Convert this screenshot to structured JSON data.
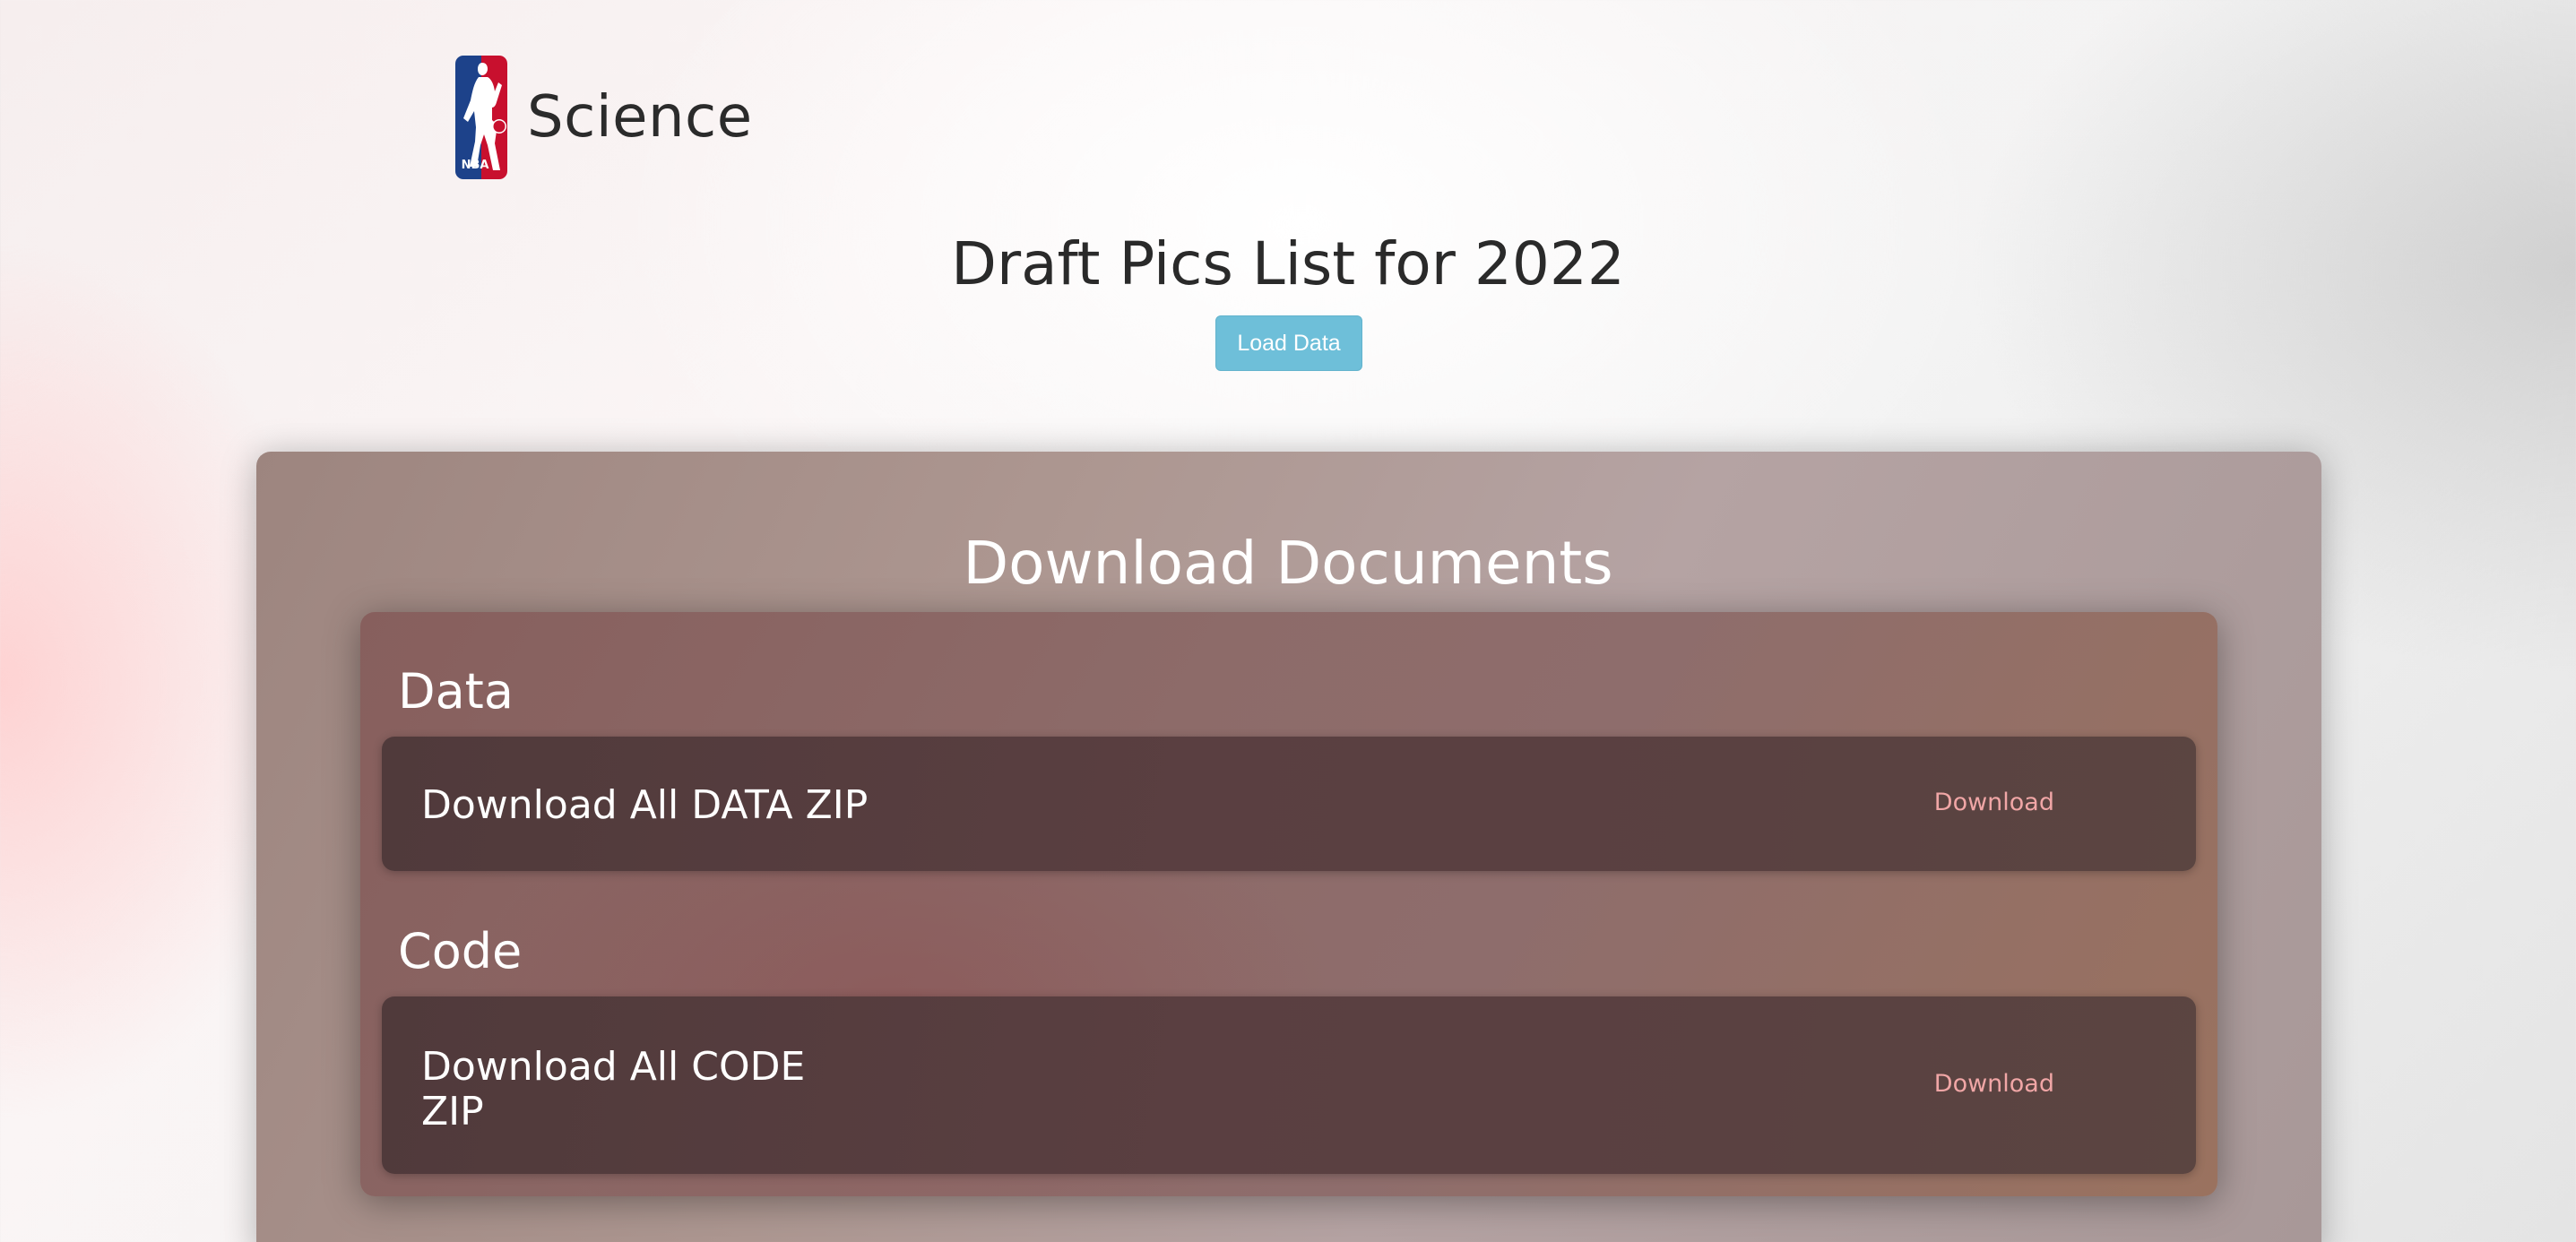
{
  "header": {
    "brand_name": "Science",
    "logo": {
      "icon": "nba-logo",
      "text": "NBA",
      "colors": {
        "blue": "#1d428a",
        "red": "#c8102e",
        "white": "#ffffff"
      }
    }
  },
  "main": {
    "title": "Draft Pics List for 2022",
    "load_button_label": "Load Data"
  },
  "downloads": {
    "title": "Download Documents",
    "sections": [
      {
        "heading": "Data",
        "item_label": "Download All DATA ZIP",
        "action_label": "Download"
      },
      {
        "heading": "Code",
        "item_label": "Download All CODE ZIP",
        "action_label": "Download"
      }
    ]
  },
  "colors": {
    "button_bg": "#6ebfd9",
    "link": "#f0a6a6",
    "card_bg": "#553d3e"
  }
}
